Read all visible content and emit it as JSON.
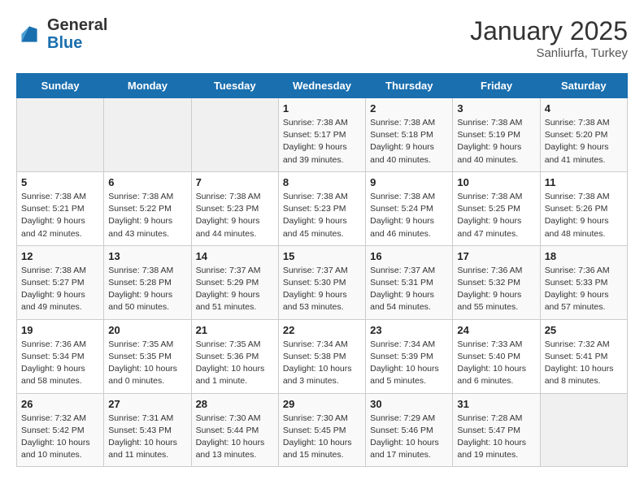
{
  "header": {
    "logo_line1": "General",
    "logo_line2": "Blue",
    "month": "January 2025",
    "location": "Sanliurfa, Turkey"
  },
  "weekdays": [
    "Sunday",
    "Monday",
    "Tuesday",
    "Wednesday",
    "Thursday",
    "Friday",
    "Saturday"
  ],
  "weeks": [
    [
      {
        "day": "",
        "info": ""
      },
      {
        "day": "",
        "info": ""
      },
      {
        "day": "",
        "info": ""
      },
      {
        "day": "1",
        "info": "Sunrise: 7:38 AM\nSunset: 5:17 PM\nDaylight: 9 hours\nand 39 minutes."
      },
      {
        "day": "2",
        "info": "Sunrise: 7:38 AM\nSunset: 5:18 PM\nDaylight: 9 hours\nand 40 minutes."
      },
      {
        "day": "3",
        "info": "Sunrise: 7:38 AM\nSunset: 5:19 PM\nDaylight: 9 hours\nand 40 minutes."
      },
      {
        "day": "4",
        "info": "Sunrise: 7:38 AM\nSunset: 5:20 PM\nDaylight: 9 hours\nand 41 minutes."
      }
    ],
    [
      {
        "day": "5",
        "info": "Sunrise: 7:38 AM\nSunset: 5:21 PM\nDaylight: 9 hours\nand 42 minutes."
      },
      {
        "day": "6",
        "info": "Sunrise: 7:38 AM\nSunset: 5:22 PM\nDaylight: 9 hours\nand 43 minutes."
      },
      {
        "day": "7",
        "info": "Sunrise: 7:38 AM\nSunset: 5:23 PM\nDaylight: 9 hours\nand 44 minutes."
      },
      {
        "day": "8",
        "info": "Sunrise: 7:38 AM\nSunset: 5:23 PM\nDaylight: 9 hours\nand 45 minutes."
      },
      {
        "day": "9",
        "info": "Sunrise: 7:38 AM\nSunset: 5:24 PM\nDaylight: 9 hours\nand 46 minutes."
      },
      {
        "day": "10",
        "info": "Sunrise: 7:38 AM\nSunset: 5:25 PM\nDaylight: 9 hours\nand 47 minutes."
      },
      {
        "day": "11",
        "info": "Sunrise: 7:38 AM\nSunset: 5:26 PM\nDaylight: 9 hours\nand 48 minutes."
      }
    ],
    [
      {
        "day": "12",
        "info": "Sunrise: 7:38 AM\nSunset: 5:27 PM\nDaylight: 9 hours\nand 49 minutes."
      },
      {
        "day": "13",
        "info": "Sunrise: 7:38 AM\nSunset: 5:28 PM\nDaylight: 9 hours\nand 50 minutes."
      },
      {
        "day": "14",
        "info": "Sunrise: 7:37 AM\nSunset: 5:29 PM\nDaylight: 9 hours\nand 51 minutes."
      },
      {
        "day": "15",
        "info": "Sunrise: 7:37 AM\nSunset: 5:30 PM\nDaylight: 9 hours\nand 53 minutes."
      },
      {
        "day": "16",
        "info": "Sunrise: 7:37 AM\nSunset: 5:31 PM\nDaylight: 9 hours\nand 54 minutes."
      },
      {
        "day": "17",
        "info": "Sunrise: 7:36 AM\nSunset: 5:32 PM\nDaylight: 9 hours\nand 55 minutes."
      },
      {
        "day": "18",
        "info": "Sunrise: 7:36 AM\nSunset: 5:33 PM\nDaylight: 9 hours\nand 57 minutes."
      }
    ],
    [
      {
        "day": "19",
        "info": "Sunrise: 7:36 AM\nSunset: 5:34 PM\nDaylight: 9 hours\nand 58 minutes."
      },
      {
        "day": "20",
        "info": "Sunrise: 7:35 AM\nSunset: 5:35 PM\nDaylight: 10 hours\nand 0 minutes."
      },
      {
        "day": "21",
        "info": "Sunrise: 7:35 AM\nSunset: 5:36 PM\nDaylight: 10 hours\nand 1 minute."
      },
      {
        "day": "22",
        "info": "Sunrise: 7:34 AM\nSunset: 5:38 PM\nDaylight: 10 hours\nand 3 minutes."
      },
      {
        "day": "23",
        "info": "Sunrise: 7:34 AM\nSunset: 5:39 PM\nDaylight: 10 hours\nand 5 minutes."
      },
      {
        "day": "24",
        "info": "Sunrise: 7:33 AM\nSunset: 5:40 PM\nDaylight: 10 hours\nand 6 minutes."
      },
      {
        "day": "25",
        "info": "Sunrise: 7:32 AM\nSunset: 5:41 PM\nDaylight: 10 hours\nand 8 minutes."
      }
    ],
    [
      {
        "day": "26",
        "info": "Sunrise: 7:32 AM\nSunset: 5:42 PM\nDaylight: 10 hours\nand 10 minutes."
      },
      {
        "day": "27",
        "info": "Sunrise: 7:31 AM\nSunset: 5:43 PM\nDaylight: 10 hours\nand 11 minutes."
      },
      {
        "day": "28",
        "info": "Sunrise: 7:30 AM\nSunset: 5:44 PM\nDaylight: 10 hours\nand 13 minutes."
      },
      {
        "day": "29",
        "info": "Sunrise: 7:30 AM\nSunset: 5:45 PM\nDaylight: 10 hours\nand 15 minutes."
      },
      {
        "day": "30",
        "info": "Sunrise: 7:29 AM\nSunset: 5:46 PM\nDaylight: 10 hours\nand 17 minutes."
      },
      {
        "day": "31",
        "info": "Sunrise: 7:28 AM\nSunset: 5:47 PM\nDaylight: 10 hours\nand 19 minutes."
      },
      {
        "day": "",
        "info": ""
      }
    ]
  ]
}
